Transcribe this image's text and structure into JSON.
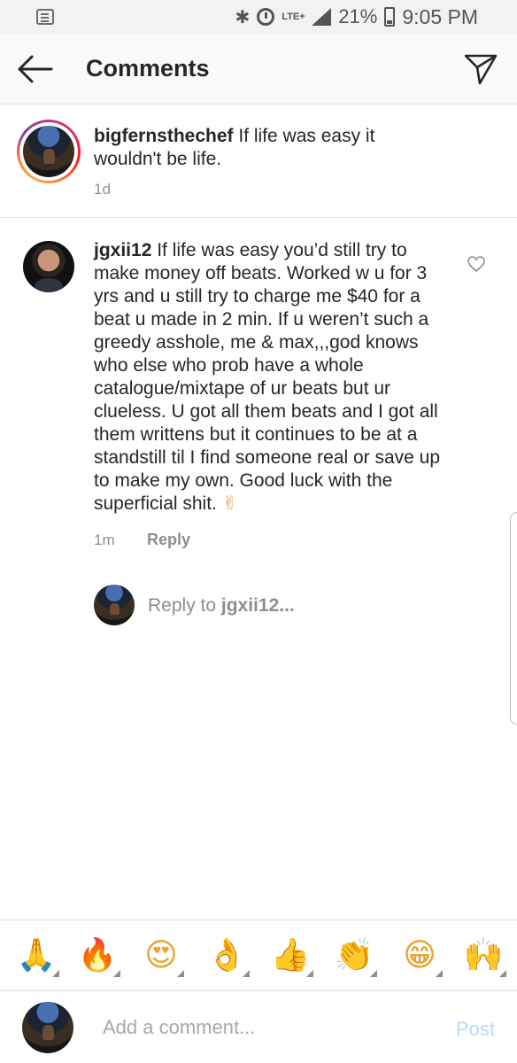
{
  "status_bar": {
    "network": "LTE+",
    "battery_percent": "21%",
    "time": "9:05 PM",
    "icons": [
      "notification-icon",
      "bluetooth-icon",
      "alarm-icon",
      "signal-icon",
      "battery-icon"
    ]
  },
  "header": {
    "title": "Comments",
    "back_icon": "arrow-left-icon",
    "share_icon": "paper-plane-icon"
  },
  "caption": {
    "username": "bigfernsthechef",
    "text": " If life was easy it wouldn't be life.",
    "time": "1d",
    "story_ring": true
  },
  "comment": {
    "username": "jgxii12",
    "text": " If life was easy you’d still try to make money off beats. Worked w u for 3 yrs and u still try to charge me $40 for a beat u made in 2 min. If u weren’t such a greedy asshole, me & max,,,god knows who else who prob have a whole catalogue/mixtape of ur beats but ur clueless. U got all them beats and I got all them writtens but it continues to be at a standstill til I find someone real or save up to make my own. Good luck with the superficial shit. ",
    "emoji": "✌",
    "time": "1m",
    "reply_label": "Reply"
  },
  "reply_prompt": {
    "prefix": "Reply to ",
    "username": "jgxii12..."
  },
  "emoji_bar": [
    "🙏",
    "🔥",
    "😍",
    "👌",
    "👍",
    "👏",
    "😁",
    "🙌"
  ],
  "composer": {
    "placeholder": "Add a comment...",
    "post_label": "Post"
  },
  "colors": {
    "accent_blue_disabled": "#b3dbff",
    "secondary_text": "#8e8e8e",
    "primary_text": "#262626",
    "divider": "#dbdbdb"
  }
}
